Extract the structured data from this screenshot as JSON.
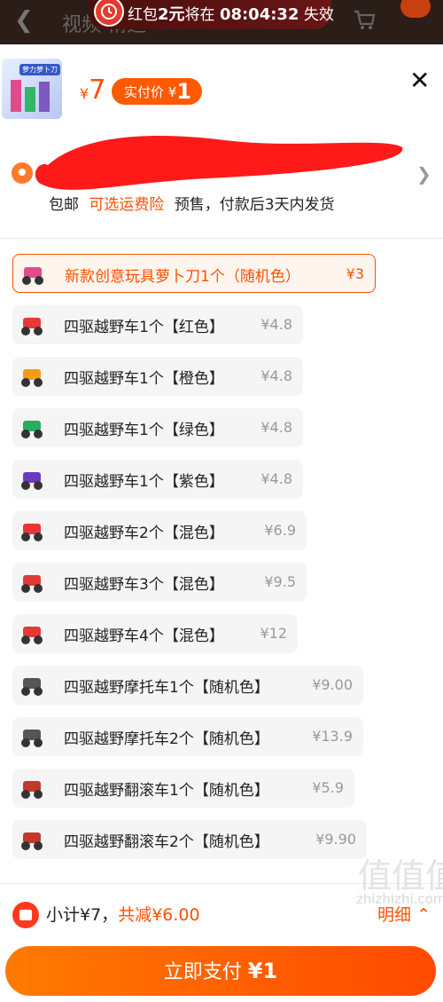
{
  "header": {
    "back_icon": "back-arrow-icon",
    "bg_title": "视频 精选",
    "cart_icon": "cart-icon"
  },
  "banner": {
    "icon": "alarm-clock-icon",
    "prefix": "红包",
    "amount": "2元",
    "middle": "将在",
    "time": "08:04:32",
    "suffix": "失效"
  },
  "product": {
    "thumb_text": "萝力萝卜刀",
    "price_symbol": "¥",
    "price": "7",
    "paid_label": "实付价",
    "paid_symbol": "¥",
    "paid_value": "1"
  },
  "address": {
    "pin_icon": "location-pin-icon",
    "shipping_free": "包邮",
    "insurance": "可选运费险",
    "presale": "预售，付款后3天内发货"
  },
  "options": [
    {
      "name": "新款创意玩具萝卜刀1个（随机色）",
      "price": "¥3",
      "selected": true,
      "color": "#e24a8a"
    },
    {
      "name": "四驱越野车1个【红色】",
      "price": "¥4.8",
      "color": "#e53935"
    },
    {
      "name": "四驱越野车1个【橙色】",
      "price": "¥4.8",
      "color": "#f39c12"
    },
    {
      "name": "四驱越野车1个【绿色】",
      "price": "¥4.8",
      "color": "#27ae60"
    },
    {
      "name": "四驱越野车1个【紫色】",
      "price": "¥4.8",
      "color": "#6a3bbf"
    },
    {
      "name": "四驱越野车2个【混色】",
      "price": "¥6.9",
      "color": "#e53935"
    },
    {
      "name": "四驱越野车3个【混色】",
      "price": "¥9.5",
      "color": "#e53935"
    },
    {
      "name": "四驱越野车4个【混色】",
      "price": "¥12",
      "color": "#e53935"
    },
    {
      "name": "四驱越野摩托车1个【随机色】",
      "price": "¥9.00",
      "color": "#555555"
    },
    {
      "name": "四驱越野摩托车2个【随机色】",
      "price": "¥13.9",
      "color": "#555555"
    },
    {
      "name": "四驱越野翻滚车1个【随机色】",
      "price": "¥5.9",
      "color": "#c0392b"
    },
    {
      "name": "四驱越野翻滚车2个【随机色】",
      "price": "¥9.90",
      "color": "#c0392b"
    }
  ],
  "footer": {
    "ticket_icon": "coupon-ticket-icon",
    "subtotal_label": "小计¥7，",
    "discount": "共减¥6.00",
    "detail_label": "明细",
    "pay_label": "立即支付",
    "pay_amount": "¥1",
    "watermark": "值值值",
    "watermark_url": "zhizhizhi.com"
  },
  "colors": {
    "accent": "#ff5000"
  }
}
